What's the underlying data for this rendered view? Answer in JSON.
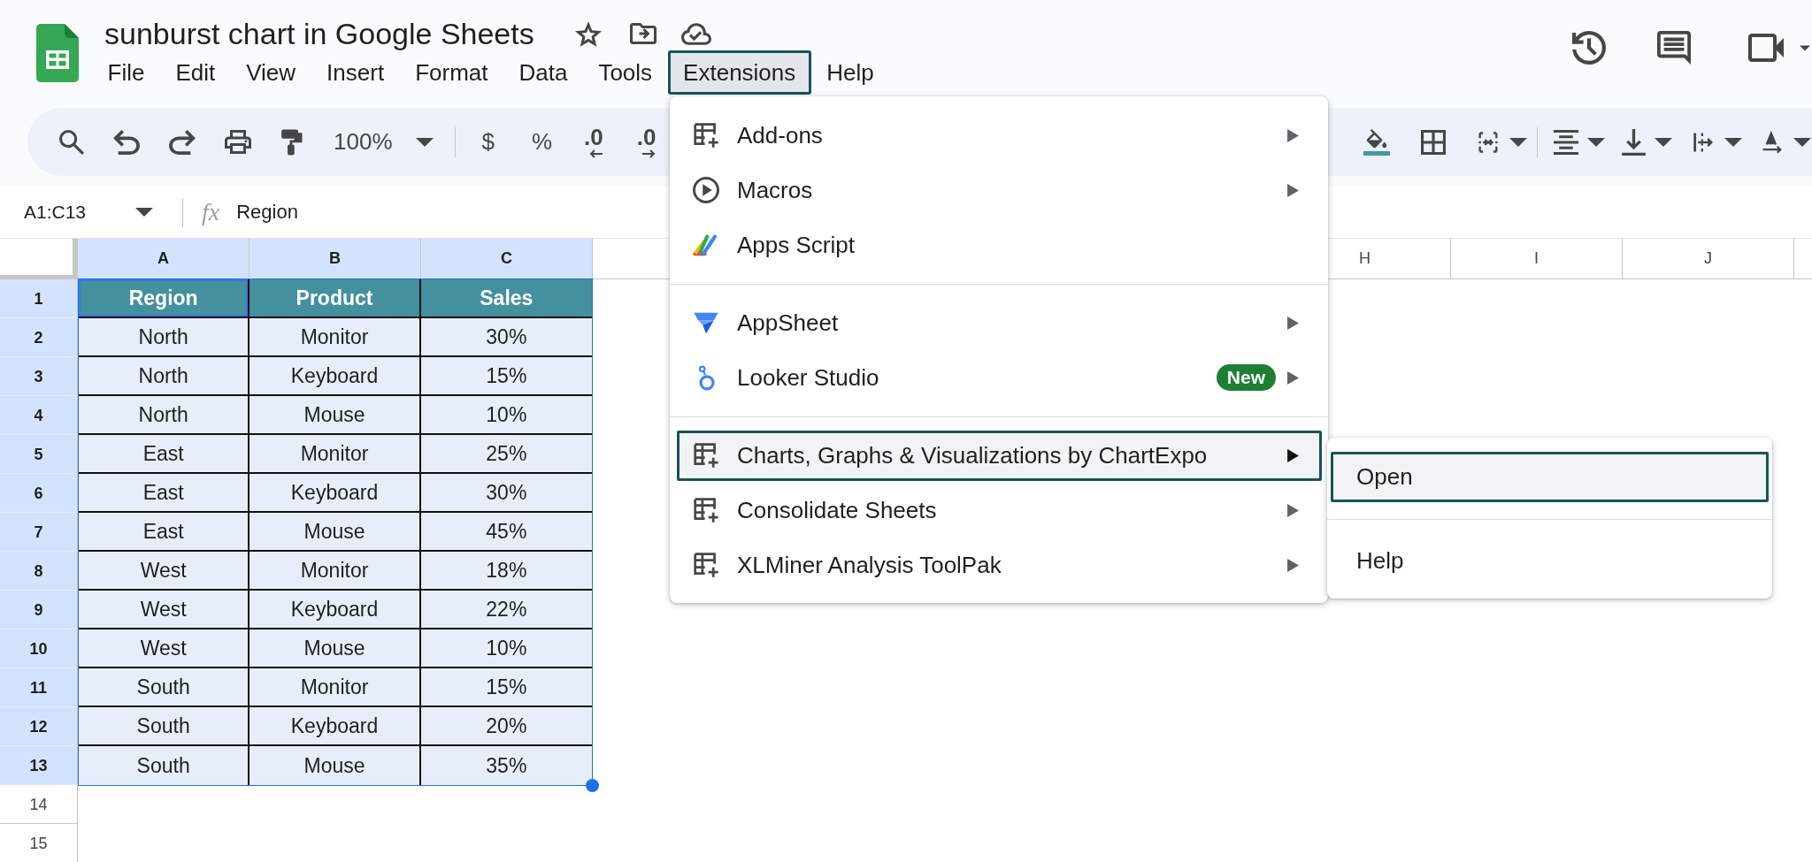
{
  "document": {
    "title": "sunburst chart in Google Sheets"
  },
  "menu_bar": [
    {
      "label": "File",
      "selected": false
    },
    {
      "label": "Edit",
      "selected": false
    },
    {
      "label": "View",
      "selected": false
    },
    {
      "label": "Insert",
      "selected": false
    },
    {
      "label": "Format",
      "selected": false
    },
    {
      "label": "Data",
      "selected": false
    },
    {
      "label": "Tools",
      "selected": false
    },
    {
      "label": "Extensions",
      "selected": true
    },
    {
      "label": "Help",
      "selected": false
    }
  ],
  "toolbar": {
    "zoom": "100%",
    "currency": "$",
    "percent": "%",
    "decrease_decimal": ".0",
    "increase_decimal": ".0"
  },
  "name_box": {
    "value": "A1:C13"
  },
  "formula_bar": {
    "label": "fx",
    "value": "Region"
  },
  "sheet": {
    "column_headers": [
      {
        "label": "A",
        "selected": true
      },
      {
        "label": "B",
        "selected": true
      },
      {
        "label": "C",
        "selected": true
      },
      {
        "label": "H",
        "selected": false
      },
      {
        "label": "I",
        "selected": false
      },
      {
        "label": "J",
        "selected": false
      }
    ],
    "row_headers": [
      {
        "label": "1",
        "selected": true
      },
      {
        "label": "2",
        "selected": true
      },
      {
        "label": "3",
        "selected": true
      },
      {
        "label": "4",
        "selected": true
      },
      {
        "label": "5",
        "selected": true
      },
      {
        "label": "6",
        "selected": true
      },
      {
        "label": "7",
        "selected": true
      },
      {
        "label": "8",
        "selected": true
      },
      {
        "label": "9",
        "selected": true
      },
      {
        "label": "10",
        "selected": true
      },
      {
        "label": "11",
        "selected": true
      },
      {
        "label": "12",
        "selected": true
      },
      {
        "label": "13",
        "selected": true
      },
      {
        "label": "14",
        "selected": false
      },
      {
        "label": "15",
        "selected": false
      }
    ]
  },
  "table": {
    "selected": true,
    "columns": [
      {
        "label": "Region",
        "active": true
      },
      {
        "label": "Product",
        "active": false
      },
      {
        "label": "Sales",
        "active": false
      }
    ],
    "rows": [
      [
        "North",
        "Monitor",
        "30%"
      ],
      [
        "North",
        "Keyboard",
        "15%"
      ],
      [
        "North",
        "Mouse",
        "10%"
      ],
      [
        "East",
        "Monitor",
        "25%"
      ],
      [
        "East",
        "Keyboard",
        "30%"
      ],
      [
        "East",
        "Mouse",
        "45%"
      ],
      [
        "West",
        "Monitor",
        "18%"
      ],
      [
        "West",
        "Keyboard",
        "22%"
      ],
      [
        "West",
        "Mouse",
        "10%"
      ],
      [
        "South",
        "Monitor",
        "15%"
      ],
      [
        "South",
        "Keyboard",
        "20%"
      ],
      [
        "South",
        "Mouse",
        "35%"
      ]
    ]
  },
  "extensions_menu": {
    "items": [
      {
        "kind": "item",
        "label": "Add-ons",
        "submenu": true,
        "selected": false
      },
      {
        "kind": "item",
        "label": "Macros",
        "submenu": true,
        "selected": false
      },
      {
        "kind": "item",
        "label": "Apps Script",
        "submenu": false,
        "selected": false
      },
      {
        "kind": "separator"
      },
      {
        "kind": "item",
        "label": "AppSheet",
        "submenu": true,
        "selected": false
      },
      {
        "kind": "item",
        "label": "Looker Studio",
        "badge": "New",
        "submenu": true,
        "selected": false
      },
      {
        "kind": "separator"
      },
      {
        "kind": "item",
        "label": "Charts, Graphs & Visualizations by ChartExpo",
        "submenu": true,
        "selected": true
      },
      {
        "kind": "item",
        "label": "Consolidate Sheets",
        "submenu": true,
        "selected": false
      },
      {
        "kind": "item",
        "label": "XLMiner Analysis ToolPak",
        "submenu": true,
        "selected": false
      }
    ]
  },
  "open_submenu": {
    "items": [
      {
        "kind": "item",
        "label": "Open",
        "selected": true
      },
      {
        "kind": "separator"
      },
      {
        "kind": "item",
        "label": "Help",
        "selected": false
      }
    ]
  }
}
